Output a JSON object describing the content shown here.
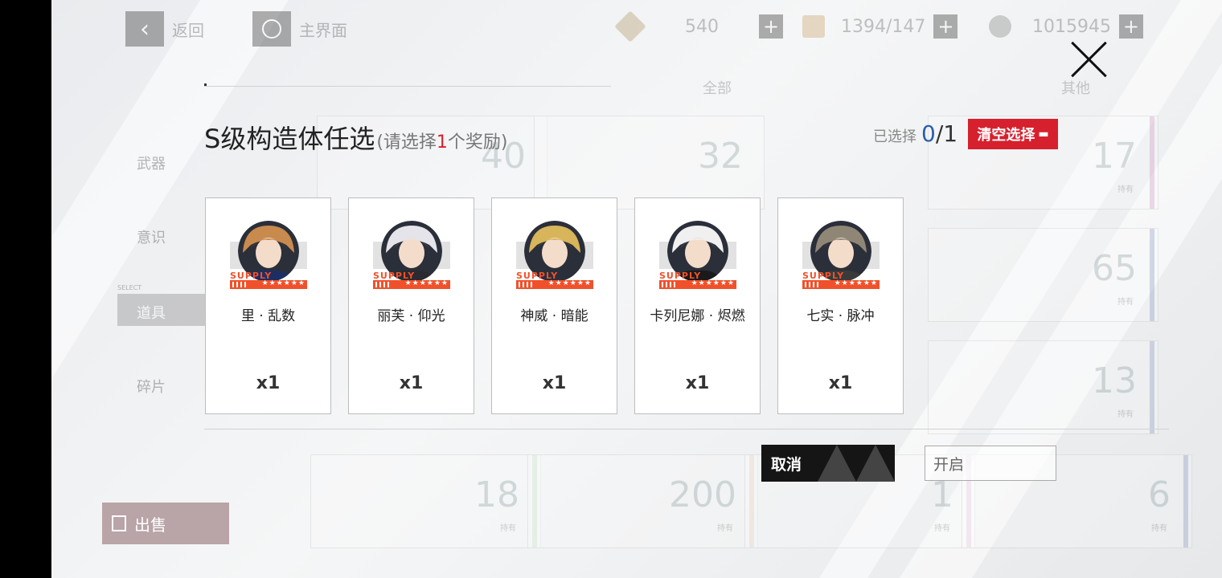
{
  "topbar": {
    "back_label": "返回",
    "home_label": "主界面",
    "resources": [
      {
        "value": "540",
        "icon": "blackcard-icon"
      },
      {
        "value": "1394/147",
        "icon": "stamina-icon"
      },
      {
        "value": "1015945",
        "icon": "coin-icon"
      }
    ]
  },
  "sidebar": {
    "items": [
      {
        "label": "武器"
      },
      {
        "label": "意识"
      },
      {
        "label": "道具"
      },
      {
        "label": "碎片"
      }
    ],
    "select_label": "SELECT"
  },
  "category_tabs": [
    {
      "label": "全部"
    },
    {
      "label": "其他"
    }
  ],
  "inventory": {
    "hold_label": "持有",
    "counts": [
      "40",
      "32",
      "17",
      "65",
      "13",
      "18",
      "200",
      "1",
      "6"
    ]
  },
  "sell_button": {
    "label": "出售"
  },
  "dialog": {
    "title": "S级构造体任选",
    "hint_prefix": "(请选择",
    "hint_count": "1",
    "hint_suffix": "个奖励)",
    "selected_label": "已选择",
    "selected_current": "0",
    "selected_total": "/1",
    "clear_label": "清空选择",
    "cancel_label": "取消",
    "confirm_label": "开启",
    "supply_text": "SUPPLY",
    "stars_text": "★★★★★★",
    "rewards": [
      {
        "name": "里 · 乱数",
        "qty": "x1",
        "hair": "#c98a4e",
        "outfit": "#1d2e63"
      },
      {
        "name": "丽芙 · 仰光",
        "qty": "x1",
        "hair": "#e4e4ea",
        "outfit": "#2a2a30"
      },
      {
        "name": "神威 · 暗能",
        "qty": "x1",
        "hair": "#d8b45a",
        "outfit": "#2b2f3a"
      },
      {
        "name": "卡列尼娜 · 烬燃",
        "qty": "x1",
        "hair": "#f0f0f0",
        "outfit": "#1a1a1a"
      },
      {
        "name": "七实 · 脉冲",
        "qty": "x1",
        "hair": "#8f8676",
        "outfit": "#3a3a3a"
      }
    ]
  }
}
